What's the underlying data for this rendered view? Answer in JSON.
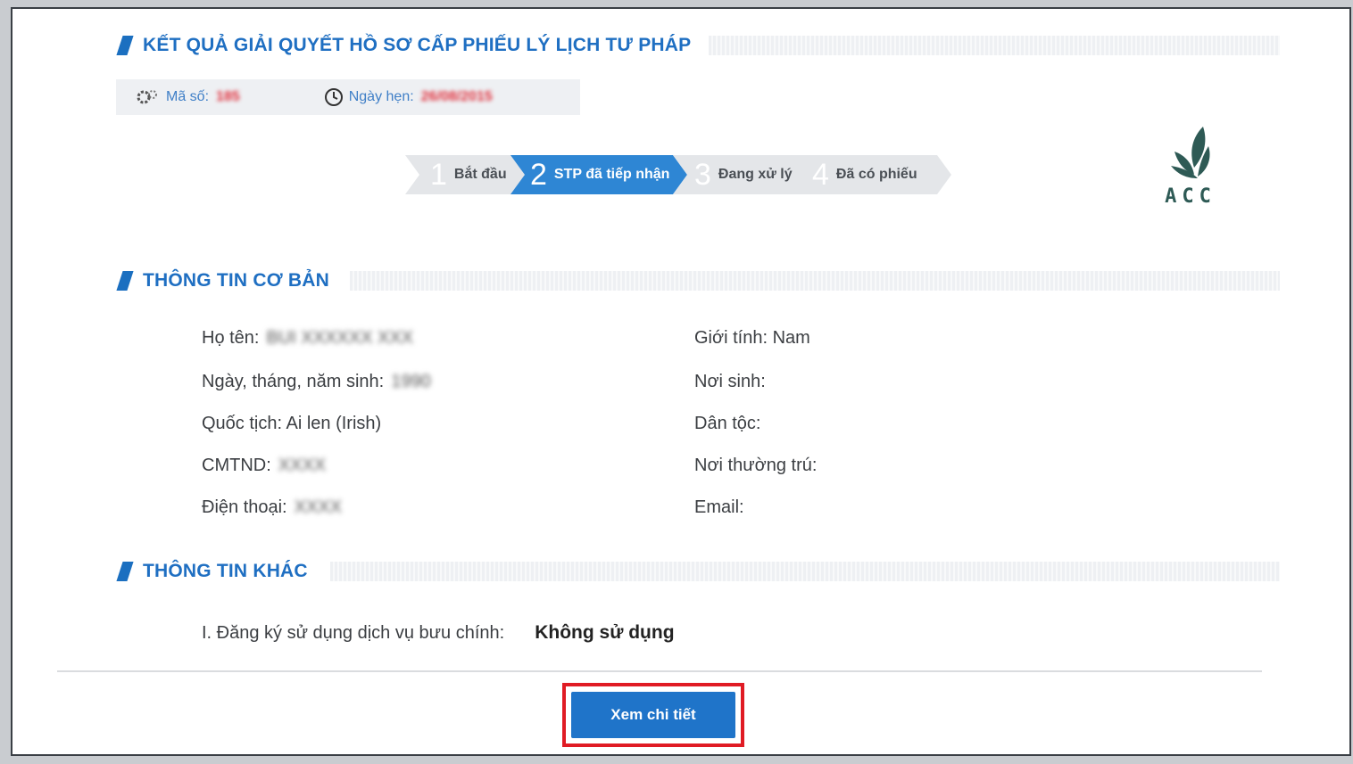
{
  "header": {
    "title": "KẾT QUẢ GIẢI QUYẾT HỒ SƠ CẤP PHIẾU LÝ LỊCH TƯ PHÁP",
    "ma_so_label": "Mã số:",
    "ma_so_value": "185",
    "ngay_hen_label": "Ngày hẹn:",
    "ngay_hen_value": "26/08/2015"
  },
  "steps": [
    {
      "num": "1",
      "label": "Bắt đầu",
      "active": false
    },
    {
      "num": "2",
      "label": "STP đã tiếp nhận",
      "active": true
    },
    {
      "num": "3",
      "label": "Đang xử lý",
      "active": false
    },
    {
      "num": "4",
      "label": "Đã có phiếu",
      "active": false
    }
  ],
  "logo": {
    "text": "ACC",
    "color": "#2e5a55"
  },
  "basic_info": {
    "title": "THÔNG TIN CƠ BẢN",
    "left": [
      {
        "label": "Họ tên:",
        "value": "BUI XXXXXX XXX"
      },
      {
        "label": "Ngày, tháng, năm sinh:",
        "value": "1990"
      },
      {
        "label": "Quốc tịch: Ai len (Irish)",
        "value": ""
      },
      {
        "label": "CMTND:",
        "value": "XXXX"
      },
      {
        "label": "Điện thoại:",
        "value": "XXXX"
      }
    ],
    "right": [
      {
        "label": "Giới tính: Nam"
      },
      {
        "label": "Nơi sinh:"
      },
      {
        "label": "Dân tộc:"
      },
      {
        "label": "Nơi thường trú:"
      },
      {
        "label": "Email:"
      }
    ]
  },
  "other_info": {
    "title": "THÔNG TIN KHÁC",
    "postal_label": "I. Đăng ký sử dụng dịch vụ bưu chính:",
    "postal_value": "Không sử dụng"
  },
  "actions": {
    "detail_button": "Xem chi tiết"
  },
  "colors": {
    "accent": "#1f6fc2",
    "highlight": "#e01b24",
    "value_red": "#e0303c"
  }
}
